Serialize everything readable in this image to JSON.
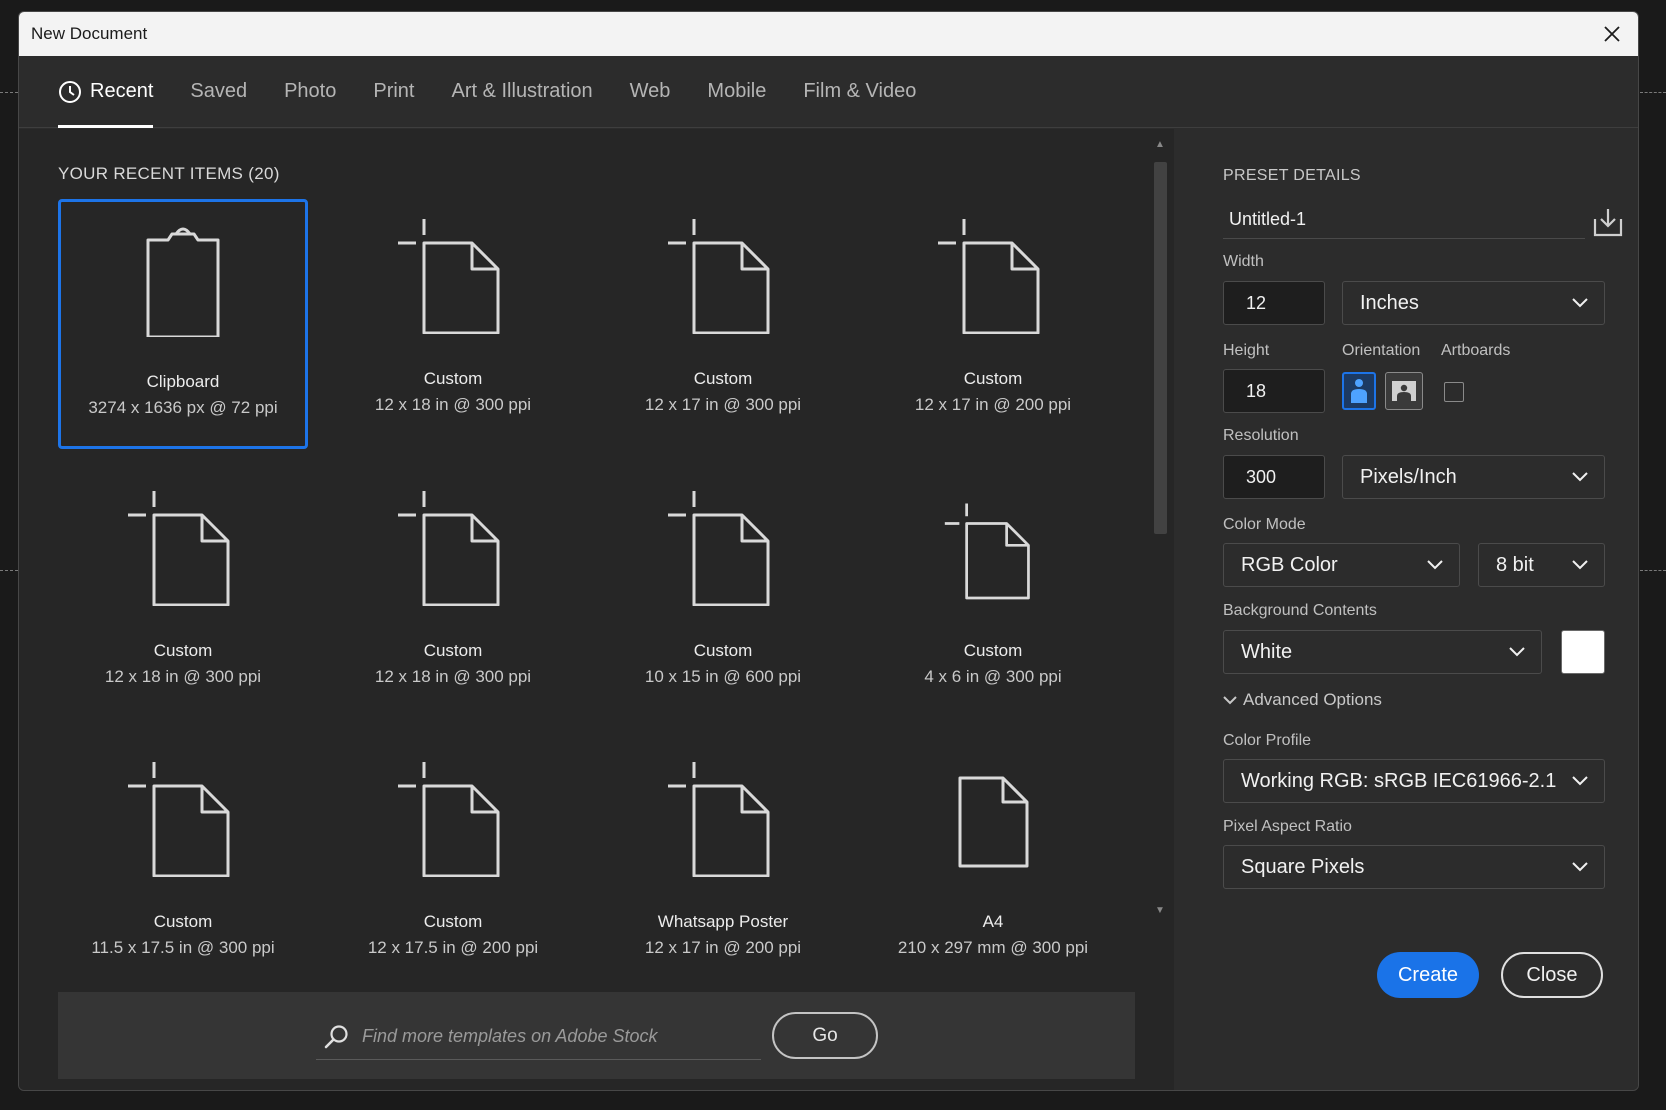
{
  "window": {
    "title": "New Document"
  },
  "tabs": [
    {
      "label": "Recent",
      "active": true
    },
    {
      "label": "Saved"
    },
    {
      "label": "Photo"
    },
    {
      "label": "Print"
    },
    {
      "label": "Art & Illustration"
    },
    {
      "label": "Web"
    },
    {
      "label": "Mobile"
    },
    {
      "label": "Film & Video"
    }
  ],
  "recent": {
    "heading": "YOUR RECENT ITEMS",
    "count": "(20)",
    "items": [
      {
        "name": "Clipboard",
        "dims": "3274 x 1636 px @ 72 ppi",
        "icon": "clipboard-icon",
        "selected": true
      },
      {
        "name": "Custom",
        "dims": "12 x 18 in @ 300 ppi",
        "icon": "custom-document-icon"
      },
      {
        "name": "Custom",
        "dims": "12 x 17 in @ 300 ppi",
        "icon": "custom-document-icon"
      },
      {
        "name": "Custom",
        "dims": "12 x 17 in @ 200 ppi",
        "icon": "custom-document-icon"
      },
      {
        "name": "Custom",
        "dims": "12 x 18 in @ 300 ppi",
        "icon": "custom-document-icon"
      },
      {
        "name": "Custom",
        "dims": "12 x 18 in @ 300 ppi",
        "icon": "custom-document-icon"
      },
      {
        "name": "Custom",
        "dims": "10 x 15 in @ 600 ppi",
        "icon": "custom-document-icon"
      },
      {
        "name": "Custom",
        "dims": "4 x 6 in @ 300 ppi",
        "icon": "custom-document-icon"
      },
      {
        "name": "Custom",
        "dims": "11.5 x 17.5 in @ 300 ppi",
        "icon": "custom-document-icon"
      },
      {
        "name": "Custom",
        "dims": "12 x 17.5 in @ 200 ppi",
        "icon": "custom-document-icon"
      },
      {
        "name": "Whatsapp Poster",
        "dims": "12 x 17 in @ 200 ppi",
        "icon": "custom-document-icon"
      },
      {
        "name": "A4",
        "dims": "210 x 297 mm @ 300 ppi",
        "icon": "document-icon"
      }
    ]
  },
  "stock": {
    "placeholder": "Find more templates on Adobe Stock",
    "go_label": "Go"
  },
  "preset": {
    "heading": "PRESET DETAILS",
    "name": "Untitled-1",
    "width_label": "Width",
    "width_value": "12",
    "width_unit": "Inches",
    "height_label": "Height",
    "height_value": "18",
    "orientation_label": "Orientation",
    "artboards_label": "Artboards",
    "orientation": "portrait",
    "artboards_checked": false,
    "resolution_label": "Resolution",
    "resolution_value": "300",
    "resolution_unit": "Pixels/Inch",
    "color_mode_label": "Color Mode",
    "color_mode": "RGB Color",
    "bit_depth": "8 bit",
    "background_label": "Background Contents",
    "background": "White",
    "background_swatch": "#ffffff",
    "advanced_label": "Advanced Options",
    "color_profile_label": "Color Profile",
    "color_profile": "Working RGB: sRGB IEC61966-2.1",
    "pixel_aspect_label": "Pixel Aspect Ratio",
    "pixel_aspect": "Square Pixels"
  },
  "actions": {
    "create_label": "Create",
    "close_label": "Close"
  },
  "colors": {
    "accent": "#1a73e8",
    "panel": "#2c2c2c",
    "grid_bg": "#262626"
  }
}
